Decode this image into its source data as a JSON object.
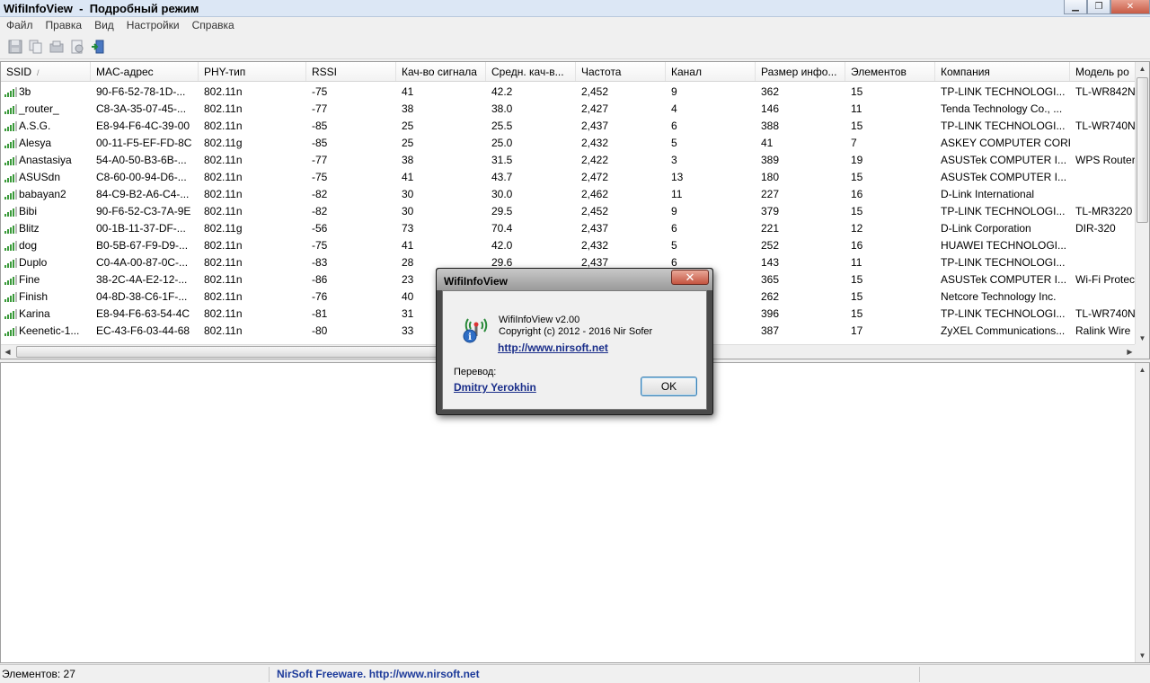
{
  "window": {
    "title": "WifiInfoView  -  Подробный режим",
    "controls": [
      "minimize",
      "maximize",
      "close"
    ]
  },
  "menu": [
    "Файл",
    "Правка",
    "Вид",
    "Настройки",
    "Справка"
  ],
  "toolbar": [
    "save-icon",
    "copy-icon",
    "html-report-icon",
    "properties-icon",
    "exit-icon"
  ],
  "columns": [
    "SSID",
    "MAC-адрес",
    "PHY-тип",
    "RSSI",
    "Кач-во сигнала",
    "Средн. кач-в...",
    "Частота",
    "Канал",
    "Размер инфо...",
    "Элементов",
    "Компания",
    "Модель ро"
  ],
  "sort_indicator": "/",
  "rows": [
    [
      "3b",
      "90-F6-52-78-1D-...",
      "802.11n",
      "-75",
      "41",
      "42.2",
      "2,452",
      "9",
      "362",
      "15",
      "TP-LINK TECHNOLOGI...",
      "TL-WR842N"
    ],
    [
      "_router_",
      "C8-3A-35-07-45-...",
      "802.11n",
      "-77",
      "38",
      "38.0",
      "2,427",
      "4",
      "146",
      "11",
      "Tenda Technology Co., ...",
      ""
    ],
    [
      "A.S.G.",
      "E8-94-F6-4C-39-00",
      "802.11n",
      "-85",
      "25",
      "25.5",
      "2,437",
      "6",
      "388",
      "15",
      "TP-LINK TECHNOLOGI...",
      "TL-WR740N"
    ],
    [
      "Alesya",
      "00-11-F5-EF-FD-8C",
      "802.11g",
      "-85",
      "25",
      "25.0",
      "2,432",
      "5",
      "41",
      "7",
      "ASKEY COMPUTER CORP",
      ""
    ],
    [
      "Anastasiya",
      "54-A0-50-B3-6B-...",
      "802.11n",
      "-77",
      "38",
      "31.5",
      "2,422",
      "3",
      "389",
      "19",
      "ASUSTek COMPUTER I...",
      "WPS Router"
    ],
    [
      "ASUSdn",
      "C8-60-00-94-D6-...",
      "802.11n",
      "-75",
      "41",
      "43.7",
      "2,472",
      "13",
      "180",
      "15",
      "ASUSTek COMPUTER I...",
      ""
    ],
    [
      "babayan2",
      "84-C9-B2-A6-C4-...",
      "802.11n",
      "-82",
      "30",
      "30.0",
      "2,462",
      "11",
      "227",
      "16",
      "D-Link International",
      ""
    ],
    [
      "Bibi",
      "90-F6-52-C3-7A-9E",
      "802.11n",
      "-82",
      "30",
      "29.5",
      "2,452",
      "9",
      "379",
      "15",
      "TP-LINK TECHNOLOGI...",
      "TL-MR3220"
    ],
    [
      "Blitz",
      "00-1B-11-37-DF-...",
      "802.11g",
      "-56",
      "73",
      "70.4",
      "2,437",
      "6",
      "221",
      "12",
      "D-Link Corporation",
      "DIR-320"
    ],
    [
      "dog",
      "B0-5B-67-F9-D9-...",
      "802.11n",
      "-75",
      "41",
      "42.0",
      "2,432",
      "5",
      "252",
      "16",
      "HUAWEI TECHNOLOGI...",
      ""
    ],
    [
      "Duplo",
      "C0-4A-00-87-0C-...",
      "802.11n",
      "-83",
      "28",
      "29.6",
      "2,437",
      "6",
      "143",
      "11",
      "TP-LINK TECHNOLOGI...",
      ""
    ],
    [
      "Fine",
      "38-2C-4A-E2-12-...",
      "802.11n",
      "-86",
      "23",
      "",
      "",
      "",
      "365",
      "15",
      "ASUSTek COMPUTER I...",
      "Wi-Fi Protec"
    ],
    [
      "Finish",
      "04-8D-38-C6-1F-...",
      "802.11n",
      "-76",
      "40",
      "",
      "",
      "",
      "262",
      "15",
      "Netcore Technology Inc.",
      ""
    ],
    [
      "Karina",
      "E8-94-F6-63-54-4C",
      "802.11n",
      "-81",
      "31",
      "",
      "",
      "",
      "396",
      "15",
      "TP-LINK TECHNOLOGI...",
      "TL-WR740N"
    ],
    [
      "Keenetic-1...",
      "EC-43-F6-03-44-68",
      "802.11n",
      "-80",
      "33",
      "",
      "",
      "",
      "387",
      "17",
      "ZyXEL Communications...",
      "Ralink Wire"
    ]
  ],
  "status": {
    "items": "Элементов: 27",
    "link": "NirSoft Freeware.  http://www.nirsoft.net"
  },
  "about_dialog": {
    "title": "WifiInfoView",
    "close": "✕",
    "product": "WifiInfoView v2.00",
    "copyright": "Copyright (c) 2012 - 2016 Nir Sofer",
    "url": "http://www.nirsoft.net",
    "translation_label": "Перевод:",
    "translator": "Dmitry Yerokhin",
    "ok": "OK"
  }
}
